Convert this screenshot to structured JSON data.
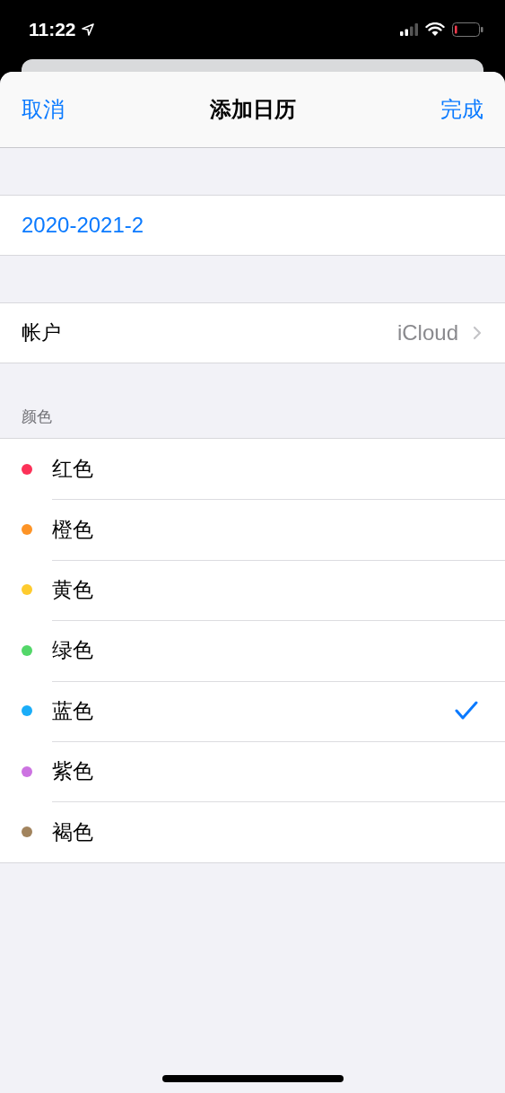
{
  "status_bar": {
    "time": "11:22"
  },
  "nav": {
    "cancel": "取消",
    "title": "添加日历",
    "done": "完成"
  },
  "name_field": {
    "value": "2020-2021-2"
  },
  "account": {
    "label": "帐户",
    "value": "iCloud"
  },
  "colors_header": "颜色",
  "colors": [
    {
      "label": "红色",
      "color": "#fc3158",
      "selected": false
    },
    {
      "label": "橙色",
      "color": "#fd9426",
      "selected": false
    },
    {
      "label": "黄色",
      "color": "#fecb2e",
      "selected": false
    },
    {
      "label": "绿色",
      "color": "#53d769",
      "selected": false
    },
    {
      "label": "蓝色",
      "color": "#1badf8",
      "selected": true
    },
    {
      "label": "紫色",
      "color": "#cc73e1",
      "selected": false
    },
    {
      "label": "褐色",
      "color": "#a2845e",
      "selected": false
    }
  ]
}
